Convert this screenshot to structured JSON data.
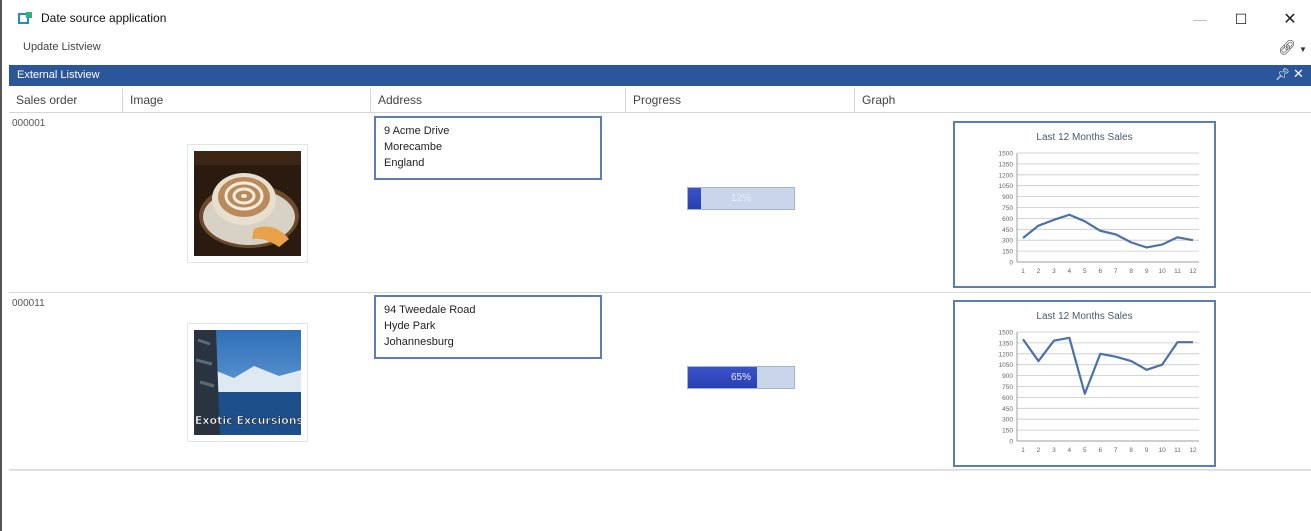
{
  "window": {
    "title": "Date source application",
    "minimize_icon": "minimize-icon",
    "maximize_icon": "maximize-icon",
    "close_icon": "close-icon"
  },
  "toolbar": {
    "update_label": "Update Listview",
    "link_icon": "link-icon",
    "dropdown_icon": "chevron-down-icon"
  },
  "panel": {
    "title": "External Listview",
    "pin_icon": "pin-icon",
    "close_icon": "close-icon"
  },
  "columns": [
    "Sales order",
    "Image",
    "Address",
    "Progress",
    "Graph"
  ],
  "rows": [
    {
      "order": "000001",
      "image": "coffee-cup-photo",
      "address": [
        "9 Acme Drive",
        "Morecambe",
        "England"
      ],
      "progress": 12,
      "progress_label": "12%"
    },
    {
      "order": "000011",
      "image": "exotic-excursions-photo",
      "image_caption": "Exotic Excursions",
      "address": [
        "94 Tweedale Road",
        "Hyde Park",
        "Johannesburg"
      ],
      "progress": 65,
      "progress_label": "65%"
    }
  ],
  "chart_data": [
    {
      "type": "line",
      "title": "Last 12 Months Sales",
      "x": [
        "1",
        "2",
        "3",
        "4",
        "5",
        "6",
        "7",
        "8",
        "9",
        "10",
        "11",
        "12"
      ],
      "values": [
        330,
        500,
        580,
        650,
        560,
        430,
        380,
        270,
        200,
        240,
        340,
        300
      ],
      "yticks": [
        "1500",
        "1350",
        "1200",
        "1050",
        "900",
        "750",
        "600",
        "450",
        "300",
        "150",
        "0"
      ],
      "ylim": [
        0,
        1500
      ],
      "grid": true,
      "color": "#4a72a8"
    },
    {
      "type": "line",
      "title": "Last 12 Months Sales",
      "x": [
        "1",
        "2",
        "3",
        "4",
        "5",
        "6",
        "7",
        "8",
        "9",
        "10",
        "11",
        "12"
      ],
      "values": [
        1400,
        1100,
        1380,
        1420,
        650,
        1200,
        1160,
        1100,
        980,
        1050,
        1360,
        1360
      ],
      "yticks": [
        "1500",
        "1350",
        "1200",
        "1050",
        "900",
        "750",
        "600",
        "450",
        "300",
        "150",
        "0"
      ],
      "ylim": [
        0,
        1500
      ],
      "grid": true,
      "color": "#4a72a8"
    }
  ],
  "colors": {
    "panel_header": "#2b579a",
    "progress_fill": "#3247c0",
    "border_accent": "#5b7fb2"
  }
}
